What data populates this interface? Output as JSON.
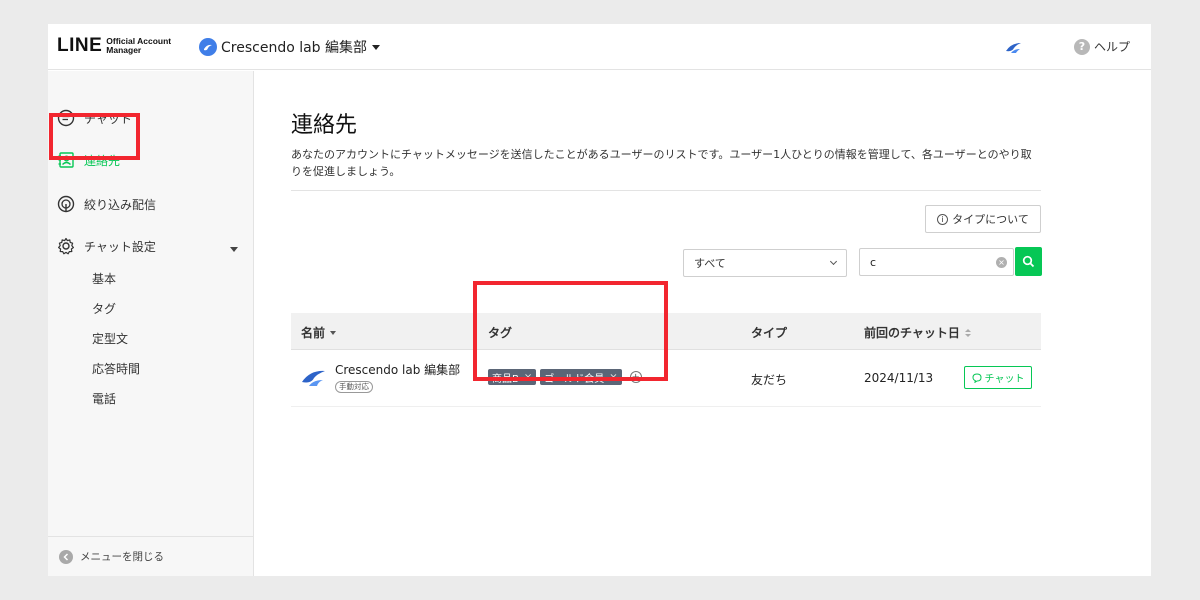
{
  "header": {
    "logo_main": "LINE",
    "logo_sub_line1": "Official Account",
    "logo_sub_line2": "Manager",
    "account_name": "Crescendo lab 編集部",
    "help_label": "ヘルプ"
  },
  "sidebar": {
    "items": [
      {
        "label": "チャット",
        "icon": "chat-bubble-icon"
      },
      {
        "label": "連絡先",
        "icon": "contacts-icon",
        "active": true
      },
      {
        "label": "絞り込み配信",
        "icon": "broadcast-icon"
      },
      {
        "label": "チャット設定",
        "icon": "gear-icon"
      }
    ],
    "sub_items": [
      "基本",
      "タグ",
      "定型文",
      "応答時間",
      "電話"
    ],
    "close_menu_label": "メニューを閉じる"
  },
  "main": {
    "title": "連絡先",
    "description": "あなたのアカウントにチャットメッセージを送信したことがあるユーザーのリストです。ユーザー1人ひとりの情報を管理して、各ユーザーとのやり取りを促進しましょう。",
    "type_info_button": "タイプについて",
    "filter": {
      "selected": "すべて"
    },
    "search": {
      "value": "c"
    },
    "table": {
      "columns": [
        "名前",
        "タグ",
        "タイプ",
        "前回のチャット日"
      ],
      "rows": [
        {
          "name": "Crescendo lab 編集部",
          "badge": "手動対応",
          "tags": [
            "商品B",
            "ゴールド会員"
          ],
          "type": "友だち",
          "last_chat": "2024/11/13",
          "action": "チャット"
        }
      ]
    }
  },
  "colors": {
    "accent_green": "#06c755",
    "highlight_red": "#f2262f",
    "tag_bg": "#5b6677"
  }
}
